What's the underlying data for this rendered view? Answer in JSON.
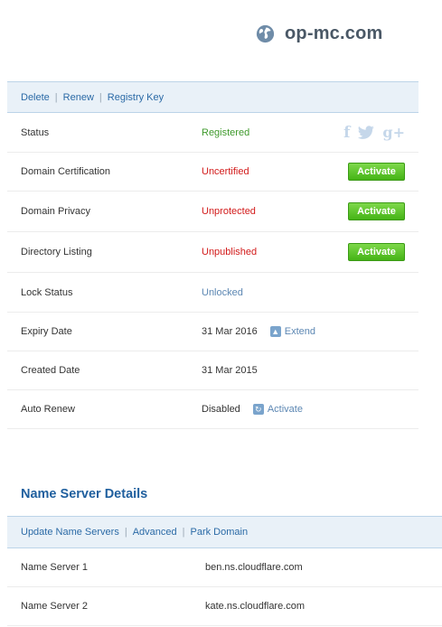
{
  "domain": {
    "name": "op-mc.com",
    "icon": "globe-icon"
  },
  "actions": [
    {
      "label": "Delete"
    },
    {
      "label": "Renew"
    },
    {
      "label": "Registry Key"
    }
  ],
  "details": [
    {
      "label": "Status",
      "value": "Registered",
      "value_color": "green",
      "extra": "social"
    },
    {
      "label": "Domain Certification",
      "value": "Uncertified",
      "value_color": "red",
      "button": "Activate"
    },
    {
      "label": "Domain Privacy",
      "value": "Unprotected",
      "value_color": "red",
      "button": "Activate"
    },
    {
      "label": "Directory Listing",
      "value": "Unpublished",
      "value_color": "red",
      "button": "Activate"
    },
    {
      "label": "Lock Status",
      "value": "Unlocked",
      "value_color": "blue"
    },
    {
      "label": "Expiry Date",
      "value": "31 Mar 2016",
      "value_color": "dark",
      "link": "Extend",
      "link_icon": "up-arrow-icon"
    },
    {
      "label": "Created Date",
      "value": "31 Mar 2015",
      "value_color": "dark"
    },
    {
      "label": "Auto Renew",
      "value": "Disabled",
      "value_color": "dark",
      "link": "Activate",
      "link_icon": "refresh-icon"
    }
  ],
  "social": {
    "facebook": "f",
    "twitter": "t",
    "googleplus": "g+"
  },
  "name_servers": {
    "title": "Name Server Details",
    "actions": [
      {
        "label": "Update Name Servers"
      },
      {
        "label": "Advanced"
      },
      {
        "label": "Park Domain"
      }
    ],
    "rows": [
      {
        "label": "Name Server 1",
        "value": "ben.ns.cloudflare.com"
      },
      {
        "label": "Name Server 2",
        "value": "kate.ns.cloudflare.com"
      }
    ]
  },
  "colors": {
    "accent": "#2b6aa6",
    "green": "#3f9a2c",
    "red": "#d21a1a",
    "button_green": "#45b416"
  }
}
